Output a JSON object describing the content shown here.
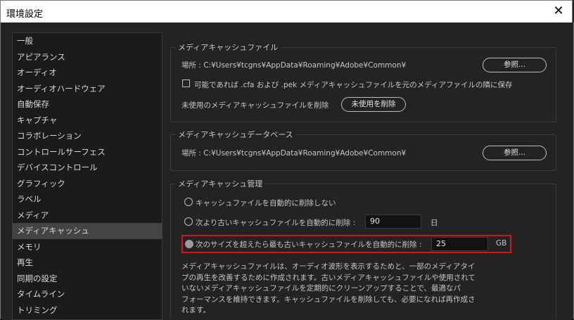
{
  "window": {
    "title": "環境設定",
    "close_glyph": "✕"
  },
  "sidebar": {
    "items": [
      "一般",
      "アピアランス",
      "オーディオ",
      "オーディオハードウェア",
      "自動保存",
      "キャプチャ",
      "コラボレーション",
      "コントロールサーフェス",
      "デバイスコントロール",
      "グラフィック",
      "ラベル",
      "メディア",
      "メディアキャッシュ",
      "メモリ",
      "再生",
      "同期の設定",
      "タイムライン",
      "トリミング"
    ],
    "active": "メディアキャッシュ"
  },
  "cache_files": {
    "title": "メディアキャッシュファイル",
    "location": "場所 :  C:¥Users¥tcgns¥AppData¥Roaming¥Adobe¥Common¥",
    "browse_label": "参照...",
    "save_next_label": "可能であれば .cfa および .pek メディアキャッシュファイルを元のメディアファイルの隣に保存",
    "save_next_checked": false,
    "remove_unused_text": "未使用のメディアキャッシュファイルを削除",
    "remove_unused_button": "未使用を削除"
  },
  "cache_db": {
    "title": "メディアキャッシュデータベース",
    "location": "場所 :  C:¥Users¥tcgns¥AppData¥Roaming¥Adobe¥Common¥",
    "browse_label": "参照..."
  },
  "cache_management": {
    "title": "メディアキャッシュ管理",
    "option_none": "キャッシュファイルを自動的に削除しない",
    "option_older": "次より古いキャッシュファイルを自動的に削除 :",
    "older_value": "90",
    "older_unit": "日",
    "option_size": "次のサイズを超えたら最も古いキャッシュファイルを自動的に削除 :",
    "size_value": "25",
    "size_unit": "GB",
    "selected_option": "size",
    "highlight_color": "#d6141c",
    "description": [
      "メディアキャッシュファイルは、オーディオ波形を表示するためと、一部のメディアタイ",
      "プの再生を改善するために作成されます。古いメディアキャッシュファイルや使用されて",
      "いないメディアキャッシュファイルを定期的にクリーンアップすることで、最適なパ",
      "フォーマンスを維持できます。キャッシュファイルを削除しても、必要になれば再作成さ",
      "れます。"
    ]
  }
}
